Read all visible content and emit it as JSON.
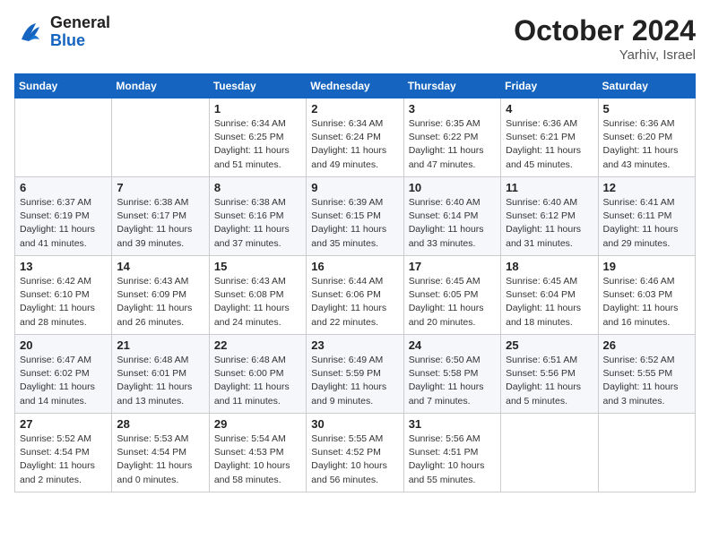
{
  "header": {
    "logo_general": "General",
    "logo_blue": "Blue",
    "month": "October 2024",
    "location": "Yarhiv, Israel"
  },
  "days_of_week": [
    "Sunday",
    "Monday",
    "Tuesday",
    "Wednesday",
    "Thursday",
    "Friday",
    "Saturday"
  ],
  "weeks": [
    [
      {
        "day": "",
        "detail": ""
      },
      {
        "day": "",
        "detail": ""
      },
      {
        "day": "1",
        "detail": "Sunrise: 6:34 AM\nSunset: 6:25 PM\nDaylight: 11 hours and 51 minutes."
      },
      {
        "day": "2",
        "detail": "Sunrise: 6:34 AM\nSunset: 6:24 PM\nDaylight: 11 hours and 49 minutes."
      },
      {
        "day": "3",
        "detail": "Sunrise: 6:35 AM\nSunset: 6:22 PM\nDaylight: 11 hours and 47 minutes."
      },
      {
        "day": "4",
        "detail": "Sunrise: 6:36 AM\nSunset: 6:21 PM\nDaylight: 11 hours and 45 minutes."
      },
      {
        "day": "5",
        "detail": "Sunrise: 6:36 AM\nSunset: 6:20 PM\nDaylight: 11 hours and 43 minutes."
      }
    ],
    [
      {
        "day": "6",
        "detail": "Sunrise: 6:37 AM\nSunset: 6:19 PM\nDaylight: 11 hours and 41 minutes."
      },
      {
        "day": "7",
        "detail": "Sunrise: 6:38 AM\nSunset: 6:17 PM\nDaylight: 11 hours and 39 minutes."
      },
      {
        "day": "8",
        "detail": "Sunrise: 6:38 AM\nSunset: 6:16 PM\nDaylight: 11 hours and 37 minutes."
      },
      {
        "day": "9",
        "detail": "Sunrise: 6:39 AM\nSunset: 6:15 PM\nDaylight: 11 hours and 35 minutes."
      },
      {
        "day": "10",
        "detail": "Sunrise: 6:40 AM\nSunset: 6:14 PM\nDaylight: 11 hours and 33 minutes."
      },
      {
        "day": "11",
        "detail": "Sunrise: 6:40 AM\nSunset: 6:12 PM\nDaylight: 11 hours and 31 minutes."
      },
      {
        "day": "12",
        "detail": "Sunrise: 6:41 AM\nSunset: 6:11 PM\nDaylight: 11 hours and 29 minutes."
      }
    ],
    [
      {
        "day": "13",
        "detail": "Sunrise: 6:42 AM\nSunset: 6:10 PM\nDaylight: 11 hours and 28 minutes."
      },
      {
        "day": "14",
        "detail": "Sunrise: 6:43 AM\nSunset: 6:09 PM\nDaylight: 11 hours and 26 minutes."
      },
      {
        "day": "15",
        "detail": "Sunrise: 6:43 AM\nSunset: 6:08 PM\nDaylight: 11 hours and 24 minutes."
      },
      {
        "day": "16",
        "detail": "Sunrise: 6:44 AM\nSunset: 6:06 PM\nDaylight: 11 hours and 22 minutes."
      },
      {
        "day": "17",
        "detail": "Sunrise: 6:45 AM\nSunset: 6:05 PM\nDaylight: 11 hours and 20 minutes."
      },
      {
        "day": "18",
        "detail": "Sunrise: 6:45 AM\nSunset: 6:04 PM\nDaylight: 11 hours and 18 minutes."
      },
      {
        "day": "19",
        "detail": "Sunrise: 6:46 AM\nSunset: 6:03 PM\nDaylight: 11 hours and 16 minutes."
      }
    ],
    [
      {
        "day": "20",
        "detail": "Sunrise: 6:47 AM\nSunset: 6:02 PM\nDaylight: 11 hours and 14 minutes."
      },
      {
        "day": "21",
        "detail": "Sunrise: 6:48 AM\nSunset: 6:01 PM\nDaylight: 11 hours and 13 minutes."
      },
      {
        "day": "22",
        "detail": "Sunrise: 6:48 AM\nSunset: 6:00 PM\nDaylight: 11 hours and 11 minutes."
      },
      {
        "day": "23",
        "detail": "Sunrise: 6:49 AM\nSunset: 5:59 PM\nDaylight: 11 hours and 9 minutes."
      },
      {
        "day": "24",
        "detail": "Sunrise: 6:50 AM\nSunset: 5:58 PM\nDaylight: 11 hours and 7 minutes."
      },
      {
        "day": "25",
        "detail": "Sunrise: 6:51 AM\nSunset: 5:56 PM\nDaylight: 11 hours and 5 minutes."
      },
      {
        "day": "26",
        "detail": "Sunrise: 6:52 AM\nSunset: 5:55 PM\nDaylight: 11 hours and 3 minutes."
      }
    ],
    [
      {
        "day": "27",
        "detail": "Sunrise: 5:52 AM\nSunset: 4:54 PM\nDaylight: 11 hours and 2 minutes."
      },
      {
        "day": "28",
        "detail": "Sunrise: 5:53 AM\nSunset: 4:54 PM\nDaylight: 11 hours and 0 minutes."
      },
      {
        "day": "29",
        "detail": "Sunrise: 5:54 AM\nSunset: 4:53 PM\nDaylight: 10 hours and 58 minutes."
      },
      {
        "day": "30",
        "detail": "Sunrise: 5:55 AM\nSunset: 4:52 PM\nDaylight: 10 hours and 56 minutes."
      },
      {
        "day": "31",
        "detail": "Sunrise: 5:56 AM\nSunset: 4:51 PM\nDaylight: 10 hours and 55 minutes."
      },
      {
        "day": "",
        "detail": ""
      },
      {
        "day": "",
        "detail": ""
      }
    ]
  ]
}
